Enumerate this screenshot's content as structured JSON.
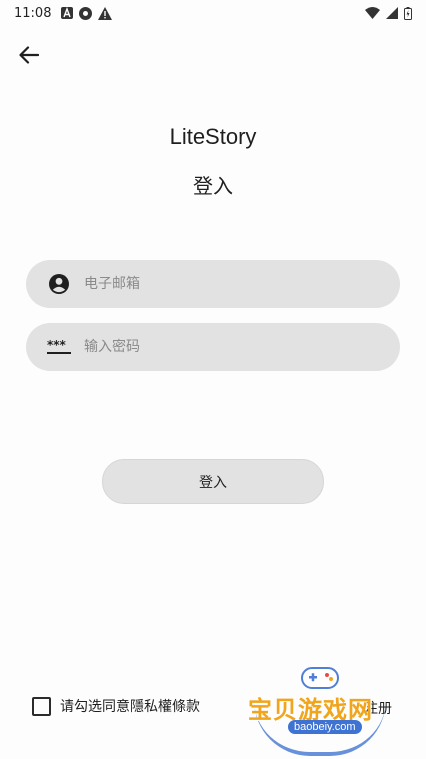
{
  "status_bar": {
    "time": "11:08"
  },
  "header": {
    "app_name": "LiteStory",
    "page_title": "登入"
  },
  "form": {
    "email_placeholder": "电子邮箱",
    "password_placeholder": "输入密码",
    "login_label": "登入"
  },
  "footer": {
    "agree_label": "请勾选同意隱私權條款",
    "register_label": "注册"
  },
  "watermark": {
    "text": "宝贝游戏网",
    "url": "baobeiy.com"
  },
  "colors": {
    "field_bg": "#e2e2e2",
    "watermark_orange": "#f1a51c",
    "watermark_blue": "#3f73d3"
  }
}
